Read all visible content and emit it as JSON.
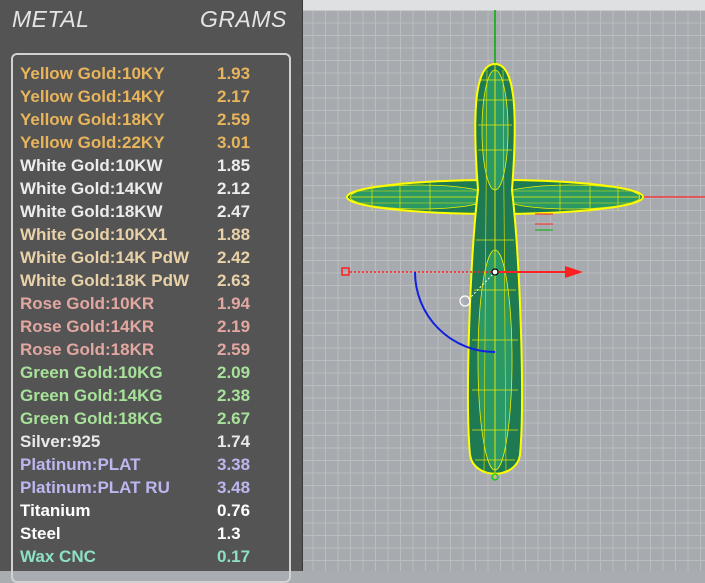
{
  "header": {
    "metal_label": "METAL",
    "grams_label": "GRAMS"
  },
  "colors": {
    "yellow": "#e8b55c",
    "white": "#ececec",
    "white_palladium": "#e9d2a8",
    "rose": "#e3a7a1",
    "green": "#a8e29a",
    "silver": "#e9e9e9",
    "platinum": "#bcb7ef",
    "titanium": "#ffffff",
    "steel": "#ffffff",
    "wax": "#8ee0c4",
    "model_outline": "#ffff00",
    "model_fill": "#1e7a52",
    "axis_x": "#ff2020",
    "axis_y": "#00b000"
  },
  "metals": [
    {
      "name": "Yellow Gold:10KY",
      "grams": "1.93",
      "color": "#e8b55c"
    },
    {
      "name": "Yellow Gold:14KY",
      "grams": "2.17",
      "color": "#e8b55c"
    },
    {
      "name": "Yellow Gold:18KY",
      "grams": "2.59",
      "color": "#e8b55c"
    },
    {
      "name": "Yellow Gold:22KY",
      "grams": "3.01",
      "color": "#e8b55c"
    },
    {
      "name": "White Gold:10KW",
      "grams": "1.85",
      "color": "#ececec"
    },
    {
      "name": "White Gold:14KW",
      "grams": "2.12",
      "color": "#ececec"
    },
    {
      "name": "White Gold:18KW",
      "grams": "2.47",
      "color": "#ececec"
    },
    {
      "name": "White Gold:10KX1",
      "grams": "1.88",
      "color": "#e9d2a8"
    },
    {
      "name": "White Gold:14K PdW",
      "grams": "2.42",
      "color": "#e9d2a8"
    },
    {
      "name": "White Gold:18K PdW",
      "grams": "2.63",
      "color": "#e9d2a8"
    },
    {
      "name": "Rose Gold:10KR",
      "grams": "1.94",
      "color": "#e3a7a1"
    },
    {
      "name": "Rose Gold:14KR",
      "grams": "2.19",
      "color": "#e3a7a1"
    },
    {
      "name": "Rose Gold:18KR",
      "grams": "2.59",
      "color": "#e3a7a1"
    },
    {
      "name": "Green Gold:10KG",
      "grams": "2.09",
      "color": "#a8e29a"
    },
    {
      "name": "Green Gold:14KG",
      "grams": "2.38",
      "color": "#a8e29a"
    },
    {
      "name": "Green Gold:18KG",
      "grams": "2.67",
      "color": "#a8e29a"
    },
    {
      "name": "Silver:925",
      "grams": "1.74",
      "color": "#e9e9e9"
    },
    {
      "name": "Platinum:PLAT",
      "grams": "3.38",
      "color": "#bcb7ef"
    },
    {
      "name": "Platinum:PLAT RU",
      "grams": "3.48",
      "color": "#bcb7ef"
    },
    {
      "name": "Titanium",
      "grams": "0.76",
      "color": "#ffffff"
    },
    {
      "name": "Steel",
      "grams": "1.3",
      "color": "#ffffff"
    },
    {
      "name": "Wax  CNC",
      "grams": "0.17",
      "color": "#8ee0c4"
    }
  ]
}
